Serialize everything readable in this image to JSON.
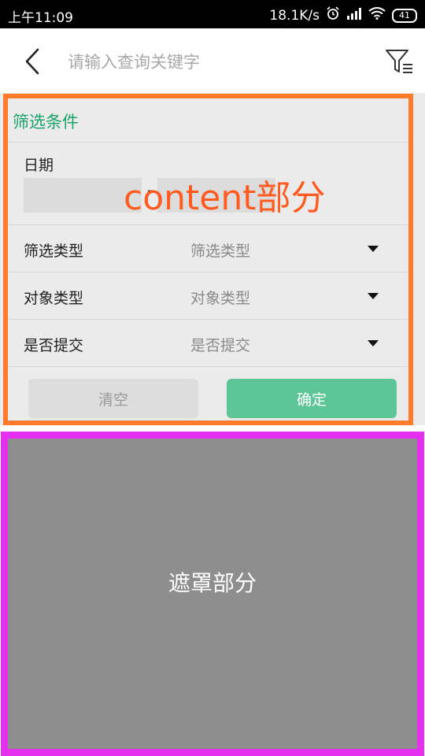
{
  "status_bar": {
    "time": "上午11:09",
    "speed": "18.1K/s",
    "battery": "41"
  },
  "search": {
    "placeholder": "请输入查询关键字"
  },
  "panel": {
    "title": "筛选条件",
    "date_label": "日期",
    "date_separator": "-",
    "overlay_label": "content部分",
    "rows": [
      {
        "label": "筛选类型",
        "value": "筛选类型"
      },
      {
        "label": "对象类型",
        "value": "对象类型"
      },
      {
        "label": "是否提交",
        "value": "是否提交"
      }
    ],
    "clear_label": "清空",
    "confirm_label": "确定"
  },
  "mask": {
    "label": "遮罩部分"
  },
  "colors": {
    "content_border": "#ff7a2a",
    "mask_border": "#e630f0",
    "confirm_button": "#5dc597",
    "title_text": "#1aa36e"
  },
  "icons": [
    "back-icon",
    "filter-icon",
    "alarm-icon",
    "signal-icon",
    "wifi-icon",
    "battery-icon",
    "dropdown-caret-icon"
  ]
}
